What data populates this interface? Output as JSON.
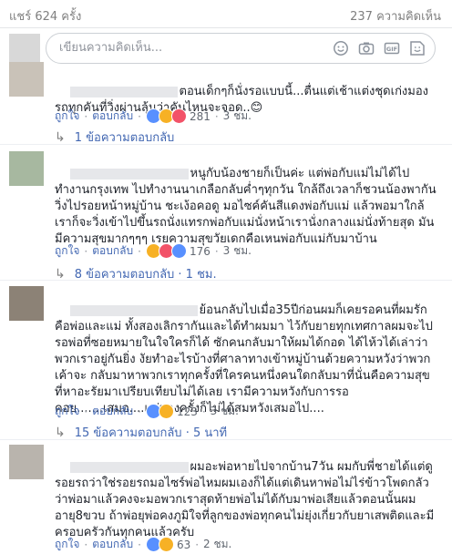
{
  "header": {
    "shares": "แชร์ 624 ครั้ง",
    "comment_count": "237 ความคิดเห็น"
  },
  "composer": {
    "placeholder": "เขียนความคิดเห็น...",
    "icons": [
      "emoji-icon",
      "camera-icon",
      "gif-icon",
      "sticker-icon"
    ]
  },
  "comments": [
    {
      "text": "ตอนเด็กๆก็นั่งรอแบบนี้...ตื่นแต่เช้าแต่งชุดเก่งมองรถทุกคันที่วิ่งผ่านลุ้นว่าคันไหนจะจอด..😊",
      "like": "ถูกใจ",
      "reply": "ตอบกลับ",
      "reaction_count": "281",
      "time": "3 ชม.",
      "replies": "1 ข้อความตอบกลับ",
      "avatar_color": "#c9c2b8"
    },
    {
      "text": "หนูกับน้องชายก็เป็นค่ะ แต่พ่อกับแม่ไม่ได้ไปทำงานกรุงเทพ ไปทำงานนาเกลือกลับค่ำๆทุกวัน ใกล้ถึงเวลาก็ชวนน้องพากันวิ่งไปรอยหน้าหมู่บ้าน ชะเง้อคอดู มอไซค์คันสีแดงพ่อกับแม่ แล้วพอมาใกล้เราก็จะวิ่งเข้าไปขึ้นรถนั่งแทรกพ่อกับแม่นั่งหน้าเรานั่งกลางแม่นั่งท้ายสุด มันมีความสุขมากๆๆๆ เรยความสุขวัยเดกคือเหนพ่อกับแม่กับมาบ้าน",
      "like": "ถูกใจ",
      "reply": "ตอบกลับ",
      "reaction_count": "176",
      "time": "3 ชม.",
      "replies": "8 ข้อความตอบกลับ · 1 ชม.",
      "avatar_color": "#a7b8a0"
    },
    {
      "text": "ย้อนกลับไปเมื่อ35ปีก่อนผมก็เคยรอคนที่ผมรักคือพ่อและแม่ ทั้งสองเลิกรากันและได้ทำผมมา ไว้กับยายทุกเทศกาลผมจะไปรอพ่อที่ซอยหมายในใจใครก็ได้ ซักคนกลับมาให้ผมได้กอด ได้ไห้วได้เล่าว่าพวกเราอยู่กันยิ่ง งัยทำอะไรบ้างที่ศาลาทางเข้าหมู่บ้านด้วยความหวังว่าพวกเค้าจะ กลับมาหาพวกเราทุกครั้งที่ใครคนหนึ่งคนใดกลับมาที่นั่นคือความสุขที่หาอะรัยมาเปรียบเทียบไม่ได้เลย เรามีความหวังกับการรอ คอย.......เสมอ....แต่บางครั้งก็ไม่ได้สมหวังเสมอไป....",
      "like": "ถูกใจ",
      "reply": "ตอบกลับ",
      "reaction_count": "123",
      "time": "3 ชม.",
      "replies": "15 ข้อความตอบกลับ · 5 นาที",
      "avatar_color": "#8c8276"
    },
    {
      "text": "ผมอะพ่อหายไปจากบ้าน7วัน ผมกับพี่ชายได้แต่ดูรอยรถว่าใช่รอยรถมอไซร์พ่อไหมผมเองก็ได้แต่เดินหาพ่อไม่ไร่ข้าวโพดกลัวว่าพ่อมาแล้วคงจะมอพวกเราสุดท้ายพ่อไม่ได้กับมาพ่อเสียแล้วตอนนั้นผมอายุ8ขวบ ถ้าพ่อยุพ่อคงภูมิใจที่ลูกของพ่อทุกคนไม่ยุ่งเกี่ยวกับยาเสพติดและมีครอบครัวกันทุกคนแล้วครับ",
      "like": "ถูกใจ",
      "reply": "ตอบกลับ",
      "reaction_count": "63",
      "time": "2 ชม.",
      "replies": "",
      "avatar_color": "#b9b4ad"
    }
  ]
}
